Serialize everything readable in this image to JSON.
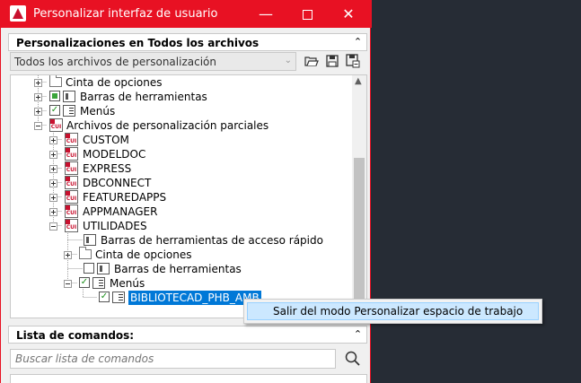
{
  "window": {
    "title": "Personalizar interfaz de usuario",
    "accent_color": "#e81123"
  },
  "customizations": {
    "header": "Personalizaciones en Todos los archivos",
    "dropdown_value": "Todos los archivos de personalización",
    "tree": [
      {
        "label": "Cinta de opciones",
        "icon": "folder-icon"
      },
      {
        "label": "Barras de herramientas",
        "icon": "toolbar-icon",
        "state": "partial"
      },
      {
        "label": "Menús",
        "icon": "menu-icon",
        "state": "checked"
      },
      {
        "label": "Archivos de personalización parciales",
        "icon": "cui-file-icon"
      },
      {
        "label": "CUSTOM",
        "icon": "cui-file-icon"
      },
      {
        "label": "MODELDOC",
        "icon": "cui-file-icon"
      },
      {
        "label": "EXPRESS",
        "icon": "cui-file-icon"
      },
      {
        "label": "DBCONNECT",
        "icon": "cui-file-icon"
      },
      {
        "label": "FEATUREDAPPS",
        "icon": "cui-file-icon"
      },
      {
        "label": "APPMANAGER",
        "icon": "cui-file-icon"
      },
      {
        "label": "UTILIDADES",
        "icon": "cui-file-icon"
      },
      {
        "label": "Barras de herramientas de acceso rápido",
        "icon": "toolbar-icon"
      },
      {
        "label": "Cinta de opciones",
        "icon": "folder-icon"
      },
      {
        "label": "Barras de herramientas",
        "icon": "toolbar-icon",
        "state": "unchecked"
      },
      {
        "label": "Menús",
        "icon": "menu-icon",
        "state": "checked"
      },
      {
        "label": "BIBLIOTECAD_PHB_AMB",
        "icon": "menu-icon",
        "state": "checked",
        "selected": true
      }
    ]
  },
  "context_menu": {
    "items": [
      {
        "label": "Salir del modo Personalizar espacio de trabajo"
      }
    ]
  },
  "commands": {
    "header": "Lista de comandos:",
    "search_placeholder": "Buscar lista de comandos"
  }
}
